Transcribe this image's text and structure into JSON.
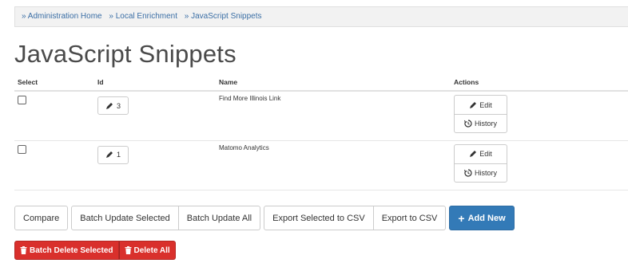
{
  "breadcrumb": {
    "items": [
      "» Administration Home",
      "» Local Enrichment",
      "» JavaScript Snippets"
    ]
  },
  "page": {
    "title": "JavaScript Snippets"
  },
  "table": {
    "columns": [
      "Select",
      "Id",
      "Name",
      "Actions"
    ],
    "rows": [
      {
        "id": "3",
        "name": "Find More Illinois Link",
        "edit": "Edit",
        "history": "History"
      },
      {
        "id": "1",
        "name": "Matomo Analytics",
        "edit": "Edit",
        "history": "History"
      }
    ]
  },
  "toolbar": {
    "compare": "Compare",
    "batch_update_selected": "Batch Update Selected",
    "batch_update_all": "Batch Update All",
    "export_selected_csv": "Export Selected to CSV",
    "export_csv": "Export to CSV",
    "add_new": "Add New"
  },
  "danger": {
    "batch_delete_selected": "Batch Delete Selected",
    "delete_all": "Delete All"
  },
  "colors": {
    "primary": "#337ab7",
    "danger": "#d9302c",
    "link": "#3a6ea5"
  }
}
